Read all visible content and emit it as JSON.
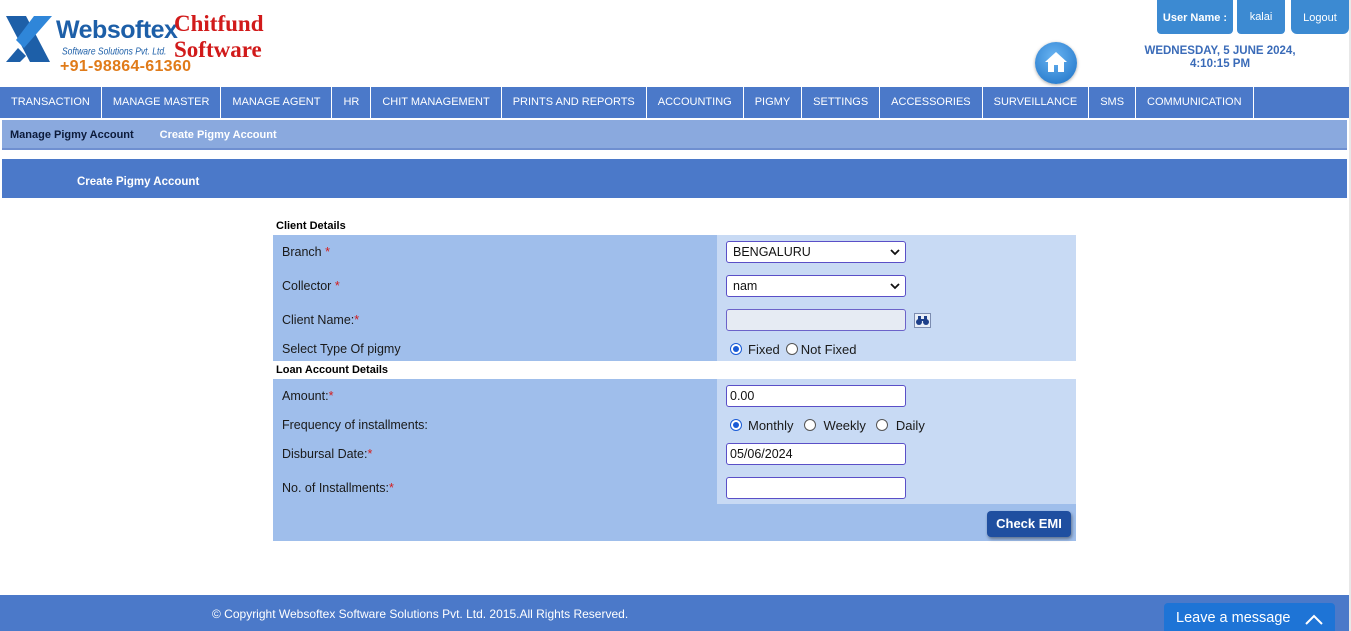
{
  "header": {
    "brand": "Websoftex",
    "brand_sub": "Software Solutions Pvt. Ltd.",
    "phone": "+91-98864-61360",
    "product_line1": "Chitfund",
    "product_line2": "Software",
    "user_label": "User Name :",
    "user_name": "kalai",
    "logout_label": "Logout",
    "date": "WEDNESDAY, 5 JUNE 2024,",
    "time": "4:10:15 PM"
  },
  "main_nav": [
    "TRANSACTION",
    "MANAGE MASTER",
    "MANAGE AGENT",
    "HR",
    "CHIT MANAGEMENT",
    "PRINTS AND REPORTS",
    "ACCOUNTING",
    "PIGMY",
    "SETTINGS",
    "ACCESSORIES",
    "SURVEILLANCE",
    "SMS",
    "COMMUNICATION"
  ],
  "sub_nav": {
    "active": "Manage Pigmy Account",
    "other": "Create Pigmy Account"
  },
  "page_title": "Create Pigmy Account",
  "client_section": {
    "heading": "Client Details",
    "branch_label": "Branch",
    "branch_value": "BENGALURU",
    "collector_label": "Collector",
    "collector_value": "nam",
    "client_name_label": "Client Name:",
    "client_name_value": "",
    "pigmy_type_label": "Select Type Of pigmy",
    "pigmy_type_options": [
      "Fixed",
      "Not Fixed"
    ],
    "pigmy_type_selected": "Fixed",
    "required_mark": "*"
  },
  "loan_section": {
    "heading": "Loan Account Details",
    "amount_label": "Amount:",
    "amount_value": "0.00",
    "frequency_label": "Frequency of installments:",
    "frequency_options": [
      "Monthly",
      "Weekly",
      "Daily"
    ],
    "frequency_selected": "Monthly",
    "disbursal_label": "Disbursal Date:",
    "disbursal_value": "05/06/2024",
    "installments_label": "No. of  Installments:",
    "installments_value": "",
    "check_emi_label": "Check EMI"
  },
  "footer": {
    "copyright": "© Copyright Websoftex Software Solutions Pvt. Ltd. 2015.All Rights Reserved.",
    "leave_message": "Leave a message"
  },
  "colors": {
    "nav_blue": "#4b79c9",
    "subnav_blue": "#8aa9de",
    "panel_left": "#9fbeeb",
    "panel_right": "#c8daf4",
    "button_blue": "#1f4fa0",
    "brand_blue": "#1d5fa8",
    "brand_red": "#d11a1a",
    "brand_orange": "#e07b19"
  }
}
